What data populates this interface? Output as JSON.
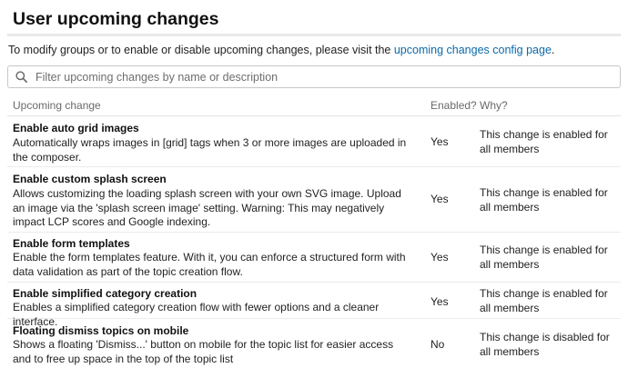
{
  "page": {
    "title": "User upcoming changes",
    "intro_text": "To modify groups or to enable or disable upcoming changes, please visit the ",
    "intro_link": "upcoming changes config page",
    "intro_end": "."
  },
  "filter": {
    "placeholder": "Filter upcoming changes by name or description",
    "value": ""
  },
  "table": {
    "headers": {
      "change": "Upcoming change",
      "enabled": "Enabled?",
      "why": "Why?"
    },
    "rows": [
      {
        "name": "Enable auto grid images",
        "description": "Automatically wraps images in [grid] tags when 3 or more images are uploaded in the composer.",
        "enabled": "Yes",
        "why": "This change is enabled for all members"
      },
      {
        "name": "Enable custom splash screen",
        "description": "Allows customizing the loading splash screen with your own SVG image. Upload an image via the 'splash screen image' setting. Warning: This may negatively impact LCP scores and Google indexing.",
        "enabled": "Yes",
        "why": "This change is enabled for all members"
      },
      {
        "name": "Enable form templates",
        "description": "Enable the form templates feature. With it, you can enforce a structured form with data validation as part of the topic creation flow.",
        "enabled": "Yes",
        "why": "This change is enabled for all members"
      },
      {
        "name": "Enable simplified category creation",
        "description": "Enables a simplified category creation flow with fewer options and a cleaner interface.",
        "enabled": "Yes",
        "why": "This change is enabled for all members"
      },
      {
        "name": "Floating dismiss topics on mobile",
        "description": "Shows a floating 'Dismiss...' button on mobile for the topic list for easier access and to free up space in the top of the topic list",
        "enabled": "No",
        "why": "This change is disabled for all members"
      }
    ]
  },
  "icons": {
    "filter": "search-icon"
  },
  "colors": {
    "link": "#0a6aa8",
    "rule": "#e9e9e9"
  }
}
